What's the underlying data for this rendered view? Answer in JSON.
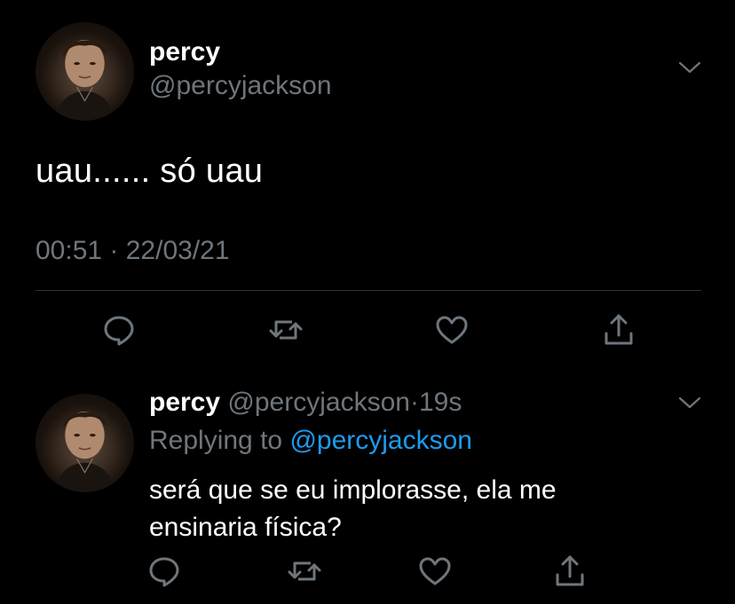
{
  "tweet": {
    "display_name": "percy",
    "handle": "@percyjackson",
    "text": "uau...... só uau",
    "timestamp": "00:51 · 22/03/21"
  },
  "actions": {
    "reply_icon": "comment-icon",
    "retweet_icon": "retweet-icon",
    "like_icon": "heart-icon",
    "share_icon": "share-icon"
  },
  "reply": {
    "display_name": "percy",
    "handle": "@percyjackson",
    "separator": "·",
    "time": "19s",
    "replying_to_label": "Replying to",
    "replying_to_handle": "@percyjackson",
    "text_line1": "será que se eu implorasse, ela me",
    "text_line2": "ensinaria física?"
  },
  "colors": {
    "background": "#000000",
    "text": "#ffffff",
    "muted": "#6e767d",
    "link": "#1d9bf0",
    "divider": "#2f3336"
  }
}
